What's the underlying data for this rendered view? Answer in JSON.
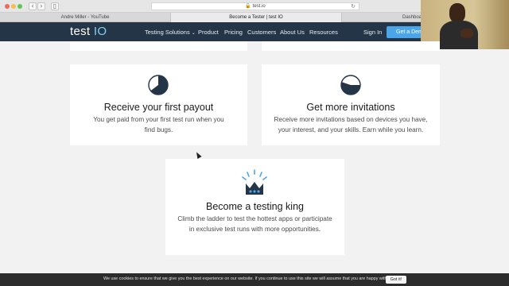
{
  "browser": {
    "url": "test.io",
    "tabs": [
      {
        "label": "Andre Miller - YouTube"
      },
      {
        "label": "Become a Tester | test IO"
      },
      {
        "label": "Dashboard"
      }
    ]
  },
  "header": {
    "logo_text": "test",
    "logo_accent": "IO",
    "nav": [
      {
        "label": "Testing Solutions"
      },
      {
        "label": "Product"
      },
      {
        "label": "Pricing"
      },
      {
        "label": "Customers"
      },
      {
        "label": "About Us"
      },
      {
        "label": "Resources"
      }
    ],
    "signin_label": "Sign In",
    "demo_label": "Get a Demo"
  },
  "cards": [
    {
      "title": "Receive your first payout",
      "text": "You get paid from your first test run when you find bugs.",
      "icon": "pie-chart-icon"
    },
    {
      "title": "Get more invitations",
      "text": "Receive more invitations based on devices you have, your interest, and your skills. Earn while you learn.",
      "icon": "pie-chart-icon"
    },
    {
      "title": "Become a testing king",
      "text": "Climb the ladder to test the hottest apps or participate in exclusive test runs with more opportunities.",
      "icon": "crown-icon"
    }
  ],
  "cookie": {
    "text": "We use cookies to ensure that we give you the best experience on our website. If you continue to use this site we will assume that you are happy with it.",
    "button_label": "Got it!"
  },
  "colors": {
    "header_bg": "#253548",
    "accent": "#4aa6e8",
    "icon_dark": "#253548"
  }
}
